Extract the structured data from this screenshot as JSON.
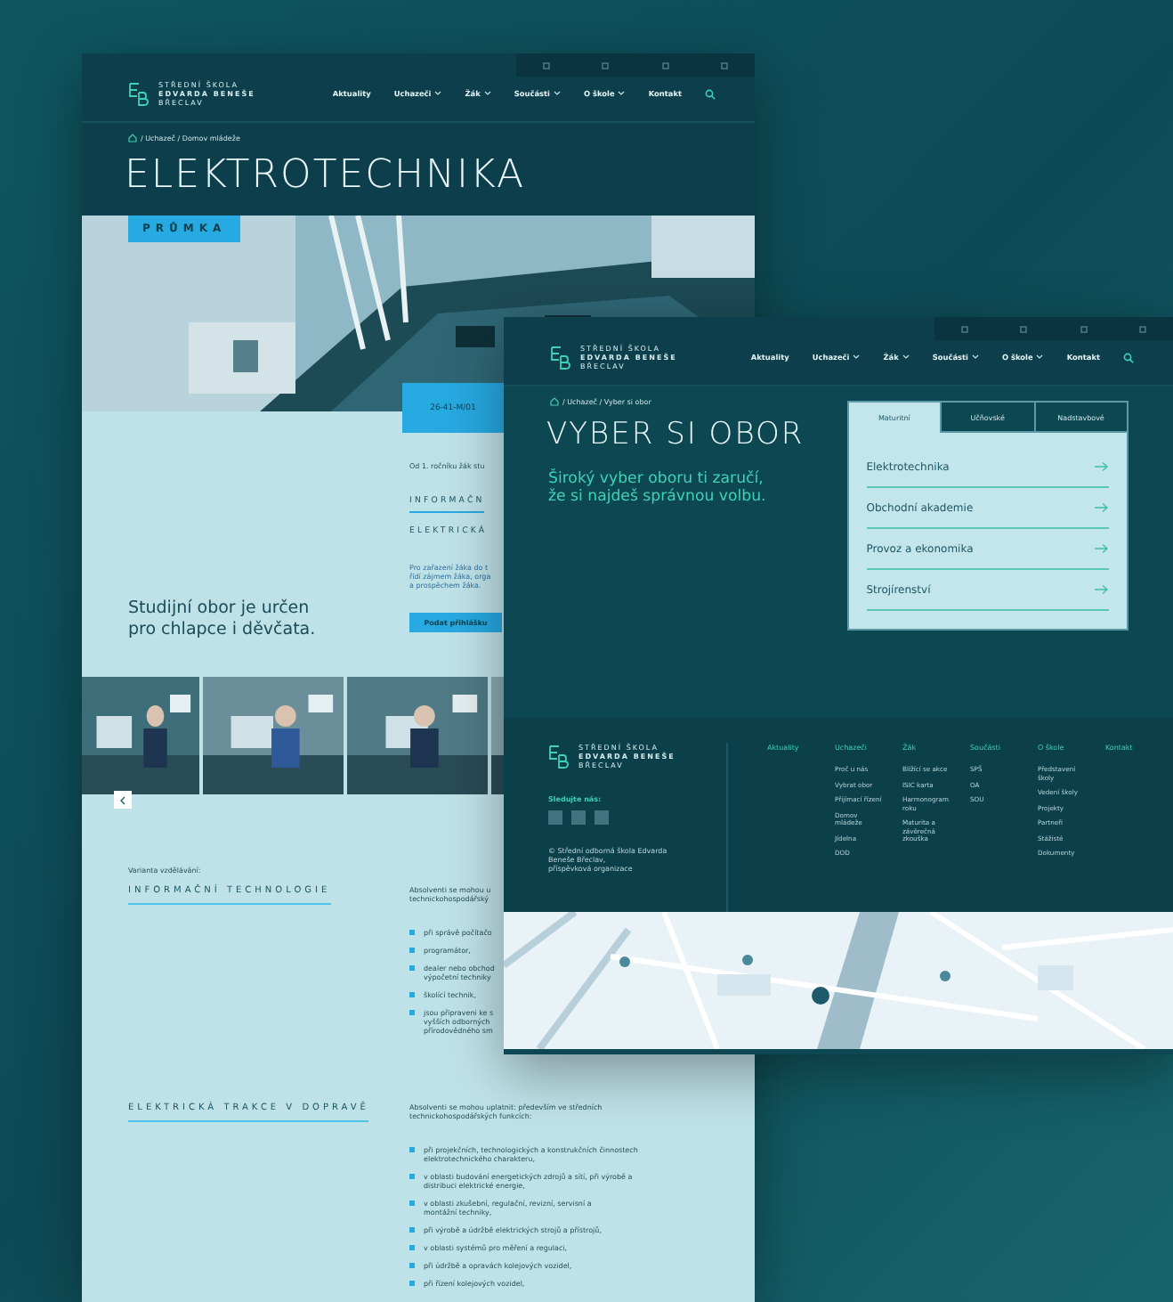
{
  "detail_page": {
    "header": {
      "logo_lines": [
        "STŘEDNÍ ŠKOLA",
        "EDVARDA BENEŠE",
        "BŘECLAV"
      ],
      "nav": [
        {
          "label": "Aktuality",
          "has_menu": false
        },
        {
          "label": "Uchazeči",
          "has_menu": true
        },
        {
          "label": "Žák",
          "has_menu": true
        },
        {
          "label": "Součásti",
          "has_menu": true
        },
        {
          "label": "O škole",
          "has_menu": true
        },
        {
          "label": "Kontakt",
          "has_menu": false
        }
      ]
    },
    "breadcrumb": "/ Uchazeč / Domov mládeže",
    "title": "ELEKTROTECHNIKA",
    "hero": {
      "kind": "picture",
      "badge": "PRŮMKA",
      "code": "26-41-M/01"
    },
    "intro": {
      "note": "Od 1. ročníku žák stu",
      "section_tabs": [
        {
          "label": "INFORMAČN",
          "selected": true
        },
        {
          "label": "ELEKTRICKÁ",
          "selected": false
        }
      ],
      "note_lines": [
        "Pro zařazení žáka do t",
        "řídí zájmem žáka, orga",
        "a prospěchem žáka."
      ],
      "apply_button": "Podat přihlášku",
      "audience_lines": [
        "Studijní obor je určen",
        "pro chlapce i děvčata."
      ]
    },
    "photos": [
      {
        "kind": "picture"
      },
      {
        "kind": "picture"
      },
      {
        "kind": "picture"
      },
      {
        "kind": "picture"
      }
    ],
    "variants_label": "Varianta vzdělávání:",
    "variants": [
      {
        "title": "INFORMAČNÍ TECHNOLOGIE",
        "intro_lines": [
          "Absolventi se mohou u",
          "technickohospodářský"
        ],
        "bullets": [
          [
            "při správě počítačo"
          ],
          [
            "programátor,"
          ],
          [
            "dealer nebo obchod",
            "výpočetní techniky"
          ],
          [
            "školící technik,"
          ],
          [
            "jsou připraveni ke s",
            "vyšších odborných",
            "přírodovědného sm"
          ]
        ]
      },
      {
        "title": "ELEKTRICKÁ TRAKCE V DOPRAVĚ",
        "intro_lines": [
          "Absolventi se mohou uplatnit: především ve středních",
          "technickohospodářských funkcích:"
        ],
        "bullets": [
          [
            "při projekčních, technologických a konstrukčních činnostech",
            "elektrotechnického charakteru,"
          ],
          [
            "v oblasti budování energetických zdrojů a sítí, při výrobě a",
            "distribuci elektrické energie,"
          ],
          [
            "v oblasti zkušební, regulační, revizní, servisní a",
            "montážní techniky,"
          ],
          [
            "při výrobě a údržbě elektrických strojů a přístrojů,"
          ],
          [
            "v oblasti systémů pro měření a regulaci,"
          ],
          [
            "při údržbě a opravách kolejových vozidel,"
          ],
          [
            "při řízení kolejových vozidel,"
          ]
        ]
      }
    ]
  },
  "overview_page": {
    "header": {
      "logo_lines": [
        "STŘEDNÍ ŠKOLA",
        "EDVARDA BENEŠE",
        "BŘECLAV"
      ],
      "nav": [
        {
          "label": "Aktuality",
          "has_menu": false
        },
        {
          "label": "Uchazeči",
          "has_menu": true
        },
        {
          "label": "Žák",
          "has_menu": true
        },
        {
          "label": "Součásti",
          "has_menu": true
        },
        {
          "label": "O škole",
          "has_menu": true
        },
        {
          "label": "Kontakt",
          "has_menu": false
        }
      ]
    },
    "breadcrumb": "/ Uchazeč / Vyber si obor",
    "title": "VYBER SI OBOR",
    "tagline_lines": [
      "Široký vyber oboru ti zaručí,",
      "že si najdeš správnou volbu."
    ],
    "tabs": [
      {
        "label": "Maturitní",
        "selected": true
      },
      {
        "label": "Učňovské",
        "selected": false
      },
      {
        "label": "Nadstavbové",
        "selected": false
      }
    ],
    "programs": [
      "Elektrotechnika",
      "Obchodní akademie",
      "Provoz a ekonomika",
      "Strojírenství"
    ],
    "footer": {
      "logo_lines": [
        "STŘEDNÍ ŠKOLA",
        "EDVARDA BENEŠE",
        "BŘECLAV"
      ],
      "follow_label": "Sledujte nás:",
      "socials": [
        {
          "kind": "square"
        },
        {
          "kind": "square"
        },
        {
          "kind": "square"
        }
      ],
      "copyright_lines": [
        "© Střední odborná škola Edvarda",
        "Beneše Břeclav,",
        "příspěvková organizace"
      ],
      "columns": [
        {
          "heading": "Aktuality"
        },
        {
          "heading": "Uchazeči",
          "links": [
            "Proč u nás",
            "Vybrat obor",
            "Přijímací řízení",
            "Domov mládeže",
            "Jídelna",
            "DOD"
          ]
        },
        {
          "heading": "Žák",
          "links": [
            "Blížící se akce",
            "ISIC karta",
            "Harmonogram roku",
            "Maturita a závěrečná zkouška"
          ]
        },
        {
          "heading": "Součásti",
          "links": [
            "SPŠ",
            "OA",
            "SOU"
          ]
        },
        {
          "heading": "O škole",
          "links": [
            "Představení školy",
            "Vedení školy",
            "Projekty",
            "Partneři",
            "Stážisté",
            "Dokumenty"
          ]
        },
        {
          "heading": "Kontakt"
        }
      ]
    },
    "map": {
      "kind": "picture"
    }
  }
}
